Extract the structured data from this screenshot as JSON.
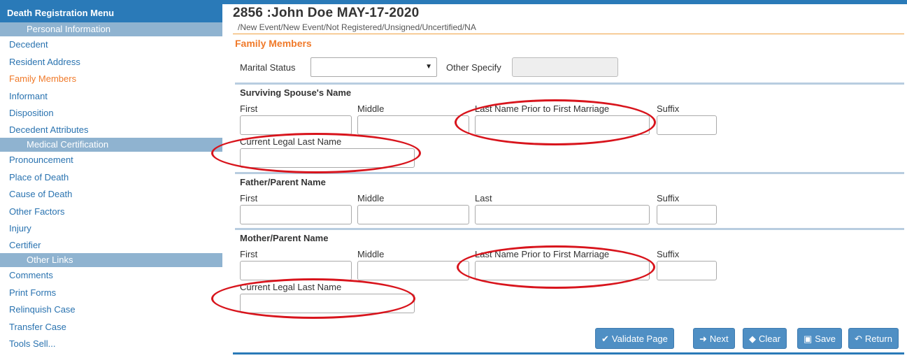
{
  "sidebar": {
    "header": "Death Registration Menu",
    "section_personal": "Personal Information",
    "items_personal": [
      "Decedent",
      "Resident Address",
      "Family Members",
      "Informant",
      "Disposition",
      "Decedent Attributes"
    ],
    "section_medical": "Medical Certification",
    "items_medical": [
      "Pronouncement",
      "Place of Death",
      "Cause of Death",
      "Other Factors",
      "Injury",
      "Certifier"
    ],
    "section_other": "Other Links",
    "items_other": [
      "Comments",
      "Print Forms",
      "Relinquish Case",
      "Transfer Case",
      "Tools Sell..."
    ]
  },
  "header": {
    "title": "2856   :John Doe  MAY-17-2020",
    "subtitle": "/New Event/New Event/Not Registered/Unsigned/Uncertified/NA",
    "section": "Family Members"
  },
  "marital": {
    "label": "Marital Status",
    "value": "",
    "other_label": "Other Specify"
  },
  "spouse": {
    "title": "Surviving Spouse's Name",
    "first": "First",
    "middle": "Middle",
    "last": "Last Name Prior to First Marriage",
    "suffix": "Suffix",
    "current": "Current Legal Last Name"
  },
  "father": {
    "title": "Father/Parent Name",
    "first": "First",
    "middle": "Middle",
    "last": "Last",
    "suffix": "Suffix"
  },
  "mother": {
    "title": "Mother/Parent Name",
    "first": "First",
    "middle": "Middle",
    "last": "Last Name Prior to First Marriage",
    "suffix": "Suffix",
    "current": "Current Legal Last Name"
  },
  "buttons": {
    "validate": "Validate Page",
    "next": "Next",
    "clear": "Clear",
    "save": "Save",
    "return": "Return"
  },
  "colors": {
    "brand_blue": "#2a7ab8",
    "section_blue": "#8fb3d0",
    "active_orange": "#f07a2a",
    "annotation_red": "#d8141c",
    "button_blue": "#4f8fc4"
  }
}
